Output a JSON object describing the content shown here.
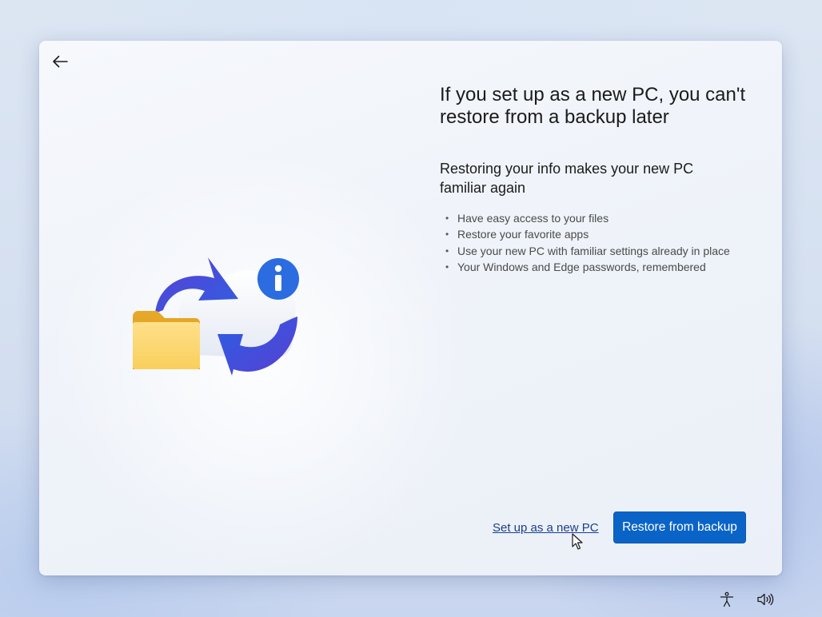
{
  "header": {
    "back_icon": "arrow-left-icon"
  },
  "illustration": {
    "name": "cloud-restore-illustration",
    "colors": {
      "folder": "#f7c948",
      "arrow": "#3b5bdb",
      "info_badge": "#2b6ce0",
      "cloud": "#ffffff"
    }
  },
  "main": {
    "title": "If you set up as a new PC, you can't restore from a backup later",
    "subtitle": "Restoring your info makes your new PC familiar again",
    "bullets": [
      "Have easy access to your files",
      "Restore your favorite apps",
      "Use your new PC with familiar settings already in place",
      "Your Windows and Edge passwords, remembered"
    ]
  },
  "actions": {
    "secondary_label": "Set up as a new PC",
    "primary_label": "Restore from backup"
  },
  "taskbar": {
    "accessibility_icon": "accessibility-icon",
    "volume_icon": "volume-icon"
  },
  "colors": {
    "accent": "#0a64c8",
    "link": "#1a3e8c"
  }
}
